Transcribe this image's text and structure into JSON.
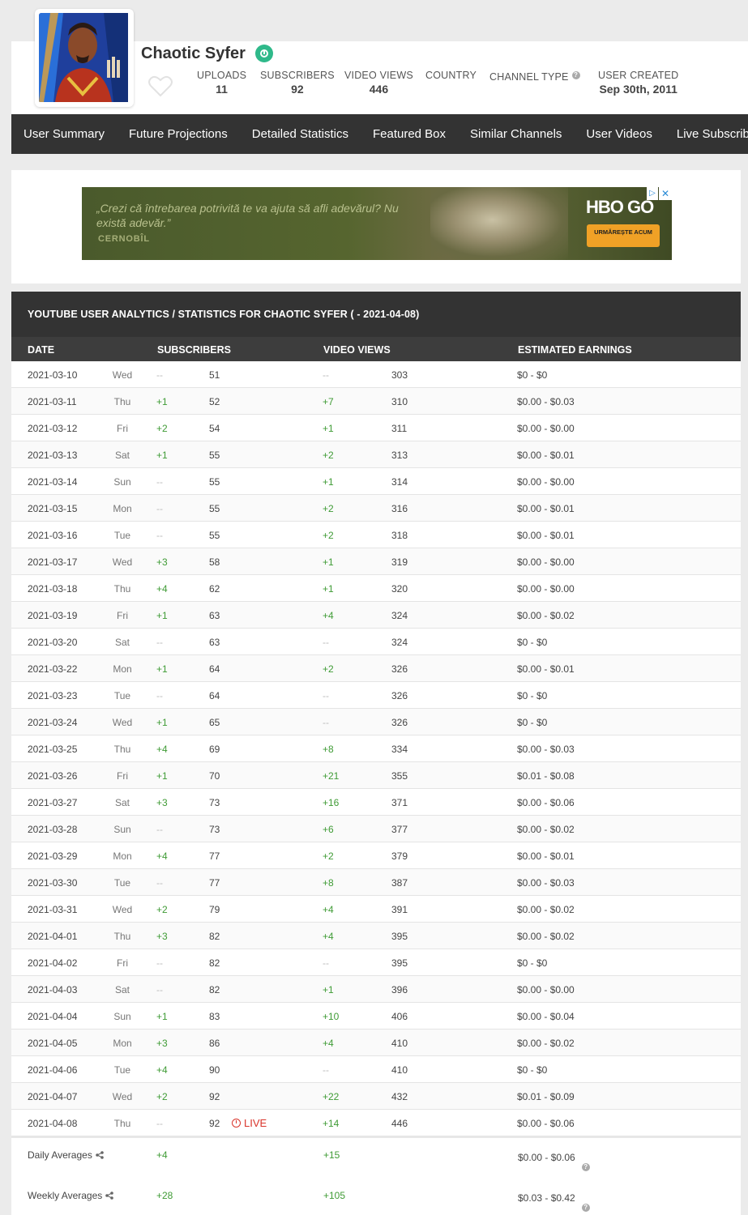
{
  "channel": {
    "name": "Chaotic Syfer",
    "stats": [
      {
        "label": "UPLOADS",
        "value": "11"
      },
      {
        "label": "SUBSCRIBERS",
        "value": "92"
      },
      {
        "label": "VIDEO VIEWS",
        "value": "446"
      },
      {
        "label": "COUNTRY",
        "value": ""
      },
      {
        "label": "CHANNEL TYPE",
        "value": ""
      },
      {
        "label": "USER CREATED",
        "value": "Sep 30th, 2011"
      }
    ]
  },
  "nav": [
    "User Summary",
    "Future Projections",
    "Detailed Statistics",
    "Featured Box",
    "Similar Channels",
    "User Videos",
    "Live Subscriber C"
  ],
  "ad": {
    "quote": "„Crezi că întrebarea potrivită te va ajuta să afli adevărul? Nu există adevăr.”",
    "show": "CERNOBÎL",
    "brand": "HBO GO",
    "cta": "URMĂREȘTE ACUM"
  },
  "table": {
    "title": "YOUTUBE USER ANALYTICS / STATISTICS FOR CHAOTIC SYFER ( - 2021-04-08)",
    "headers": {
      "date": "DATE",
      "subscribers": "SUBSCRIBERS",
      "views": "VIDEO VIEWS",
      "earnings": "ESTIMATED EARNINGS"
    },
    "live_label": "LIVE",
    "rows": [
      {
        "date": "2021-03-10",
        "day": "Wed",
        "sub_delta": "--",
        "subs": "51",
        "view_delta": "--",
        "views": "303",
        "earnings": "$0  -  $0"
      },
      {
        "date": "2021-03-11",
        "day": "Thu",
        "sub_delta": "+1",
        "subs": "52",
        "view_delta": "+7",
        "views": "310",
        "earnings": "$0.00  -  $0.03"
      },
      {
        "date": "2021-03-12",
        "day": "Fri",
        "sub_delta": "+2",
        "subs": "54",
        "view_delta": "+1",
        "views": "311",
        "earnings": "$0.00  -  $0.00"
      },
      {
        "date": "2021-03-13",
        "day": "Sat",
        "sub_delta": "+1",
        "subs": "55",
        "view_delta": "+2",
        "views": "313",
        "earnings": "$0.00  -  $0.01"
      },
      {
        "date": "2021-03-14",
        "day": "Sun",
        "sub_delta": "--",
        "subs": "55",
        "view_delta": "+1",
        "views": "314",
        "earnings": "$0.00  -  $0.00"
      },
      {
        "date": "2021-03-15",
        "day": "Mon",
        "sub_delta": "--",
        "subs": "55",
        "view_delta": "+2",
        "views": "316",
        "earnings": "$0.00  -  $0.01"
      },
      {
        "date": "2021-03-16",
        "day": "Tue",
        "sub_delta": "--",
        "subs": "55",
        "view_delta": "+2",
        "views": "318",
        "earnings": "$0.00  -  $0.01"
      },
      {
        "date": "2021-03-17",
        "day": "Wed",
        "sub_delta": "+3",
        "subs": "58",
        "view_delta": "+1",
        "views": "319",
        "earnings": "$0.00  -  $0.00"
      },
      {
        "date": "2021-03-18",
        "day": "Thu",
        "sub_delta": "+4",
        "subs": "62",
        "view_delta": "+1",
        "views": "320",
        "earnings": "$0.00  -  $0.00"
      },
      {
        "date": "2021-03-19",
        "day": "Fri",
        "sub_delta": "+1",
        "subs": "63",
        "view_delta": "+4",
        "views": "324",
        "earnings": "$0.00  -  $0.02"
      },
      {
        "date": "2021-03-20",
        "day": "Sat",
        "sub_delta": "--",
        "subs": "63",
        "view_delta": "--",
        "views": "324",
        "earnings": "$0  -  $0"
      },
      {
        "date": "2021-03-22",
        "day": "Mon",
        "sub_delta": "+1",
        "subs": "64",
        "view_delta": "+2",
        "views": "326",
        "earnings": "$0.00  -  $0.01"
      },
      {
        "date": "2021-03-23",
        "day": "Tue",
        "sub_delta": "--",
        "subs": "64",
        "view_delta": "--",
        "views": "326",
        "earnings": "$0  -  $0"
      },
      {
        "date": "2021-03-24",
        "day": "Wed",
        "sub_delta": "+1",
        "subs": "65",
        "view_delta": "--",
        "views": "326",
        "earnings": "$0  -  $0"
      },
      {
        "date": "2021-03-25",
        "day": "Thu",
        "sub_delta": "+4",
        "subs": "69",
        "view_delta": "+8",
        "views": "334",
        "earnings": "$0.00  -  $0.03"
      },
      {
        "date": "2021-03-26",
        "day": "Fri",
        "sub_delta": "+1",
        "subs": "70",
        "view_delta": "+21",
        "views": "355",
        "earnings": "$0.01  -  $0.08"
      },
      {
        "date": "2021-03-27",
        "day": "Sat",
        "sub_delta": "+3",
        "subs": "73",
        "view_delta": "+16",
        "views": "371",
        "earnings": "$0.00  -  $0.06"
      },
      {
        "date": "2021-03-28",
        "day": "Sun",
        "sub_delta": "--",
        "subs": "73",
        "view_delta": "+6",
        "views": "377",
        "earnings": "$0.00  -  $0.02"
      },
      {
        "date": "2021-03-29",
        "day": "Mon",
        "sub_delta": "+4",
        "subs": "77",
        "view_delta": "+2",
        "views": "379",
        "earnings": "$0.00  -  $0.01"
      },
      {
        "date": "2021-03-30",
        "day": "Tue",
        "sub_delta": "--",
        "subs": "77",
        "view_delta": "+8",
        "views": "387",
        "earnings": "$0.00  -  $0.03"
      },
      {
        "date": "2021-03-31",
        "day": "Wed",
        "sub_delta": "+2",
        "subs": "79",
        "view_delta": "+4",
        "views": "391",
        "earnings": "$0.00  -  $0.02"
      },
      {
        "date": "2021-04-01",
        "day": "Thu",
        "sub_delta": "+3",
        "subs": "82",
        "view_delta": "+4",
        "views": "395",
        "earnings": "$0.00  -  $0.02"
      },
      {
        "date": "2021-04-02",
        "day": "Fri",
        "sub_delta": "--",
        "subs": "82",
        "view_delta": "--",
        "views": "395",
        "earnings": "$0  -  $0"
      },
      {
        "date": "2021-04-03",
        "day": "Sat",
        "sub_delta": "--",
        "subs": "82",
        "view_delta": "+1",
        "views": "396",
        "earnings": "$0.00  -  $0.00"
      },
      {
        "date": "2021-04-04",
        "day": "Sun",
        "sub_delta": "+1",
        "subs": "83",
        "view_delta": "+10",
        "views": "406",
        "earnings": "$0.00  -  $0.04"
      },
      {
        "date": "2021-04-05",
        "day": "Mon",
        "sub_delta": "+3",
        "subs": "86",
        "view_delta": "+4",
        "views": "410",
        "earnings": "$0.00  -  $0.02"
      },
      {
        "date": "2021-04-06",
        "day": "Tue",
        "sub_delta": "+4",
        "subs": "90",
        "view_delta": "--",
        "views": "410",
        "earnings": "$0  -  $0"
      },
      {
        "date": "2021-04-07",
        "day": "Wed",
        "sub_delta": "+2",
        "subs": "92",
        "view_delta": "+22",
        "views": "432",
        "earnings": "$0.01  -  $0.09"
      },
      {
        "date": "2021-04-08",
        "day": "Thu",
        "sub_delta": "--",
        "subs": "92",
        "view_delta": "+14",
        "views": "446",
        "earnings": "$0.00  -  $0.06",
        "live": true
      }
    ],
    "averages": [
      {
        "label": "Daily Averages",
        "subs": "+4",
        "views": "+15",
        "earnings": "$0.00  -  $0.06"
      },
      {
        "label": "Weekly Averages",
        "subs": "+28",
        "views": "+105",
        "earnings": "$0.03  -  $0.42"
      }
    ]
  },
  "colors": {
    "positive": "#3f9b35",
    "live": "#d9342b",
    "verified": "#2fb98a",
    "nav_bg": "#333333"
  }
}
